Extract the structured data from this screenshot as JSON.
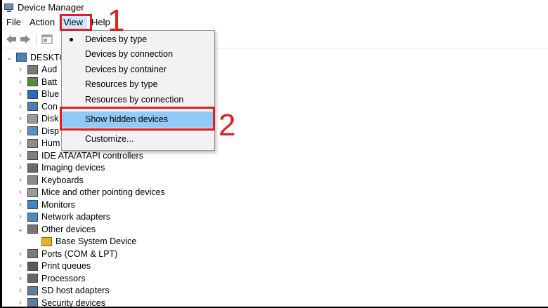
{
  "window": {
    "title": "Device Manager"
  },
  "menubar": {
    "items": [
      "File",
      "Action",
      "View",
      "Help"
    ]
  },
  "view_menu": {
    "items": [
      {
        "label": "Devices by type",
        "checked": true
      },
      {
        "label": "Devices by connection"
      },
      {
        "label": "Devices by container"
      },
      {
        "label": "Resources by type"
      },
      {
        "label": "Resources by connection"
      },
      {
        "label": "Show hidden devices",
        "highlighted": true
      },
      {
        "label": "Customize..."
      }
    ]
  },
  "tree": {
    "root": "DESKTO",
    "items": [
      {
        "label": "Aud",
        "icon": "audio-icon"
      },
      {
        "label": "Batt",
        "icon": "battery-icon"
      },
      {
        "label": "Blue",
        "icon": "bluetooth-icon"
      },
      {
        "label": "Con",
        "icon": "computer-icon"
      },
      {
        "label": "Disk",
        "icon": "disk-icon"
      },
      {
        "label": "Disp",
        "icon": "display-icon"
      },
      {
        "label": "Hum",
        "icon": "hid-icon"
      },
      {
        "label": "IDE ATA/ATAPI controllers",
        "icon": "ide-icon"
      },
      {
        "label": "Imaging devices",
        "icon": "camera-icon"
      },
      {
        "label": "Keyboards",
        "icon": "keyboard-icon"
      },
      {
        "label": "Mice and other pointing devices",
        "icon": "mouse-icon"
      },
      {
        "label": "Monitors",
        "icon": "monitor-icon"
      },
      {
        "label": "Network adapters",
        "icon": "network-icon"
      },
      {
        "label": "Other devices",
        "icon": "other-devices-icon",
        "expanded": true
      },
      {
        "label": "Base System Device",
        "icon": "warning-device-icon",
        "child": true
      },
      {
        "label": "Ports (COM & LPT)",
        "icon": "port-icon"
      },
      {
        "label": "Print queues",
        "icon": "printer-icon"
      },
      {
        "label": "Processors",
        "icon": "processor-icon"
      },
      {
        "label": "SD host adapters",
        "icon": "sd-icon"
      },
      {
        "label": "Security devices",
        "icon": "security-icon"
      }
    ]
  },
  "annotations": {
    "step1": "1",
    "step2": "2"
  },
  "colors": {
    "annotation": "#e01f1f",
    "menu_highlight": "#91c9f7",
    "menu_active": "#cce8ff"
  }
}
